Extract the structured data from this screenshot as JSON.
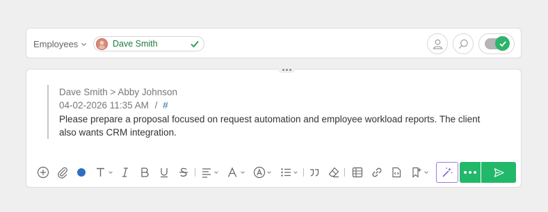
{
  "header": {
    "employees_label": "Employees",
    "selected_user": "Dave Smith",
    "icons": [
      "user-icon",
      "search-icon"
    ],
    "toggle_state": "on"
  },
  "message": {
    "header": "Dave Smith > Abby Johnson",
    "timestamp": "04-02-2026 11:35 AM",
    "separator": "/",
    "link": "#",
    "body": "Please prepare a proposal focused on request automation and employee workload reports. The client also wants CRM integration."
  },
  "toolbar": {
    "tools": [
      "add-icon",
      "attach-icon",
      "color-dot",
      "text-style-icon",
      "italic-icon",
      "bold-icon",
      "underline-icon",
      "strikethrough-icon",
      "align-icon",
      "font-size-icon",
      "font-color-icon",
      "list-icon",
      "quote-icon",
      "eraser-icon",
      "table-icon",
      "link-icon",
      "code-icon",
      "template-icon",
      "ai-magic-icon",
      "more-icon",
      "send-icon"
    ]
  },
  "colors": {
    "accent_green": "#21b86a",
    "text_color_dot": "#2f6fc1",
    "ai_border": "#9d7be0"
  }
}
